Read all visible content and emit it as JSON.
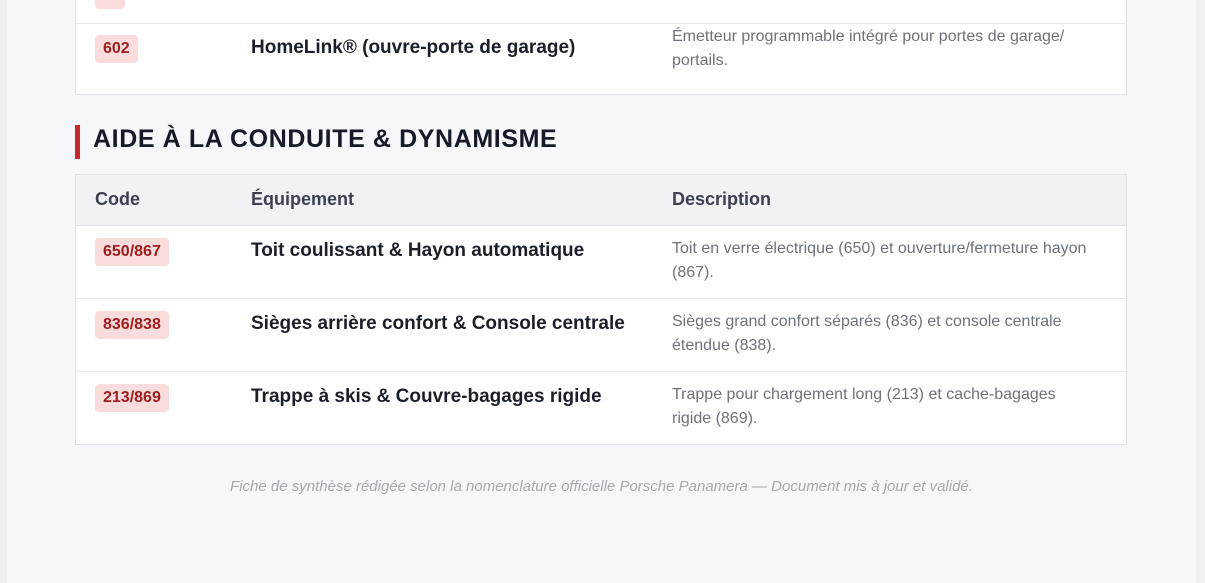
{
  "prev_table": {
    "row": {
      "code": "602",
      "equipment": "HomeLink® (ouvre-porte de garage)",
      "description": "Émetteur programmable intégré pour portes de garage/ portails."
    }
  },
  "section": {
    "title": "AIDE À LA CONDUITE & DYNAMISME"
  },
  "table": {
    "headers": {
      "code": "Code",
      "equipment": "Équipement",
      "description": "Description"
    },
    "rows": [
      {
        "code": "650/867",
        "equipment": "Toit coulissant & Hayon automatique",
        "description": "Toit en verre électrique (650) et ouverture/fermeture hayon (867)."
      },
      {
        "code": "836/838",
        "equipment": "Sièges arrière confort & Console centrale",
        "description": "Sièges grand confort séparés (836) et console centrale étendue (838)."
      },
      {
        "code": "213/869",
        "equipment": "Trappe à skis & Couvre-bagages rigide",
        "description": "Trappe pour chargement long (213) et cache-bagages rigide (869)."
      }
    ]
  },
  "footer": {
    "text": "Fiche de synthèse rédigée selon la nomenclature officielle Porsche Panamera — Document mis à jour et validé."
  },
  "colors": {
    "accent": "#c8282c",
    "badge_bg": "#fbdcdc",
    "badge_text": "#9d1c1c"
  }
}
